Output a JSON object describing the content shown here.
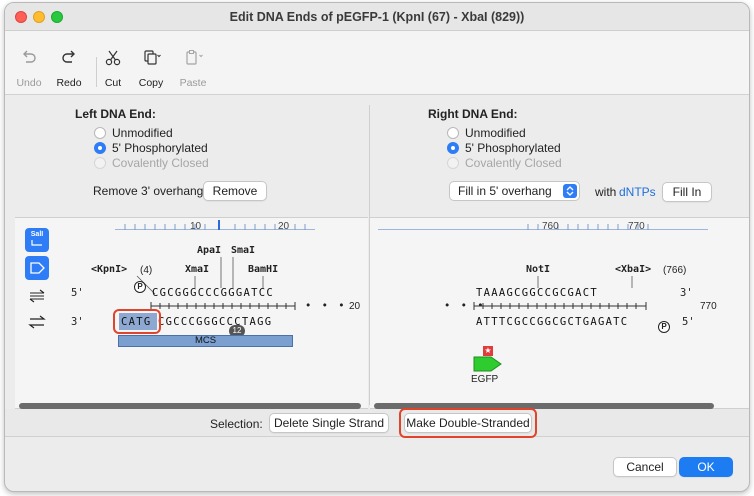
{
  "window": {
    "title": "Edit DNA Ends of pEGFP-1 (KpnI (67) - XbaI (829))"
  },
  "toolbar": {
    "undo": "Undo",
    "redo": "Redo",
    "cut": "Cut",
    "copy": "Copy",
    "paste": "Paste"
  },
  "left": {
    "title": "Left DNA End:",
    "options": [
      "Unmodified",
      "5' Phosphorylated",
      "Covalently Closed"
    ],
    "selected": "5' Phosphorylated",
    "overhang_label": "Remove 3' overhang",
    "remove_button": "Remove"
  },
  "right": {
    "title": "Right DNA End:",
    "options": [
      "Unmodified",
      "5' Phosphorylated",
      "Covalently Closed"
    ],
    "selected": "5' Phosphorylated",
    "fill_select": "Fill in 5' overhang",
    "with_label": "with",
    "dntps_link": "dNTPs",
    "fill_button": "Fill In"
  },
  "left_seq": {
    "ruler_ticks": [
      "10",
      "20"
    ],
    "side_icons": [
      "sall-icon",
      "feature-icon",
      "double-strand-icon",
      "swap-strands-icon"
    ],
    "side_icon_label": "SalI",
    "enzymes": [
      {
        "name": "<KpnI>",
        "pos": "(4)"
      },
      {
        "name": "ApaI"
      },
      {
        "name": "SmaI"
      },
      {
        "name": "XmaI"
      },
      {
        "name": "BamHI"
      }
    ],
    "top_strand_prefix": "5'",
    "top_strand": "CGCGGGCCCGGGATCC",
    "bottom_strand_prefix": "3'",
    "bottom_overhang": "CATG",
    "bottom_strand": "CGCCCGGGCCCTAGG",
    "ellipsis": "• • •",
    "end_number": "20",
    "phosphate": "P",
    "badge": "12",
    "feature": "MCS"
  },
  "right_seq": {
    "ruler_ticks": [
      "760",
      "770"
    ],
    "enzymes": [
      {
        "name": "NotI"
      },
      {
        "name": "<XbaI>",
        "pos": "(766)"
      }
    ],
    "top_strand": "TAAAGCGGCCGCGACT",
    "top_strand_suffix": "3'",
    "bottom_strand": "ATTTCGCCGGCGCTGAGATC",
    "bottom_strand_suffix": "5'",
    "ellipsis": "• • •",
    "end_number": "770",
    "phosphate": "P",
    "feature": "EGFP"
  },
  "status": {
    "selection_label": "Selection:",
    "delete_button": "Delete Single Strand",
    "double_button": "Make Double-Stranded"
  },
  "footer": {
    "cancel": "Cancel",
    "ok": "OK"
  },
  "colors": {
    "accent": "#1e7cf2",
    "highlight": "#e0452b",
    "feature": "#7b9fcf",
    "selection": "#8ea9d1"
  }
}
